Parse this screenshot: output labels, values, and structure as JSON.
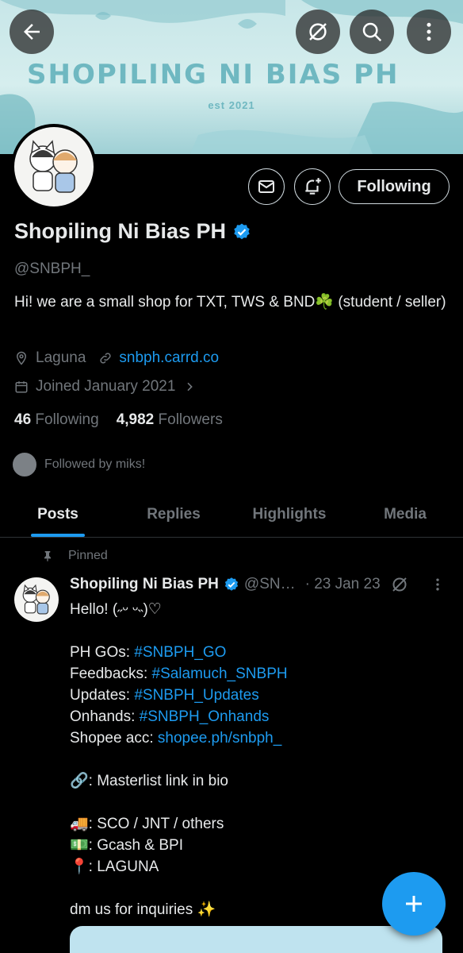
{
  "banner": {
    "title": "SHOPILING NI BIAS PH",
    "subtitle": "est 2021"
  },
  "header_buttons": {
    "back": "back-arrow-icon",
    "grok": "grok-icon",
    "search": "search-icon",
    "more": "more-vertical-icon"
  },
  "profile": {
    "actions": {
      "following_label": "Following"
    },
    "name": "Shopiling Ni Bias PH",
    "handle": "@SNBPH_",
    "bio": "Hi! we are a small shop for TXT, TWS & BND☘️ (student / seller)",
    "location": "Laguna",
    "website": "snbph.carrd.co",
    "joined": "Joined January 2021",
    "following_count": "46",
    "following_label": "Following",
    "followers_count": "4,982",
    "followers_label": "Followers",
    "followed_by": "Followed by miks!"
  },
  "tabs": [
    {
      "label": "Posts",
      "active": true
    },
    {
      "label": "Replies"
    },
    {
      "label": "Highlights"
    },
    {
      "label": "Media"
    }
  ],
  "post": {
    "pinned_label": "Pinned",
    "author": "Shopiling Ni Bias PH",
    "handle": "@SN…",
    "date": "· 23 Jan 23",
    "lines": {
      "l1": "Hello! (˶ᵕ ᵕ˵)♡",
      "go_prefix": "PH GOs: ",
      "go_tag": "#SNBPH_GO",
      "fb_prefix": "Feedbacks: ",
      "fb_tag": "#Salamuch_SNBPH",
      "up_prefix": "Updates: ",
      "up_tag": "#SNBPH_Updates",
      "on_prefix": "Onhands: ",
      "on_tag": "#SNBPH_Onhands",
      "sh_prefix": "Shopee acc: ",
      "sh_link": "shopee.ph/snbph_",
      "masterlist": "🔗: Masterlist link in bio",
      "shipping": "🚚: SCO / JNT / others",
      "payment": "💵: Gcash & BPI",
      "location": "📍: LAGUNA",
      "dm": "dm us for inquiries ✨"
    }
  },
  "colors": {
    "accent": "#1d9bf0",
    "background": "#000000",
    "muted": "#71767b",
    "text": "#e7e9ea",
    "banner": "#c7e6e8"
  }
}
